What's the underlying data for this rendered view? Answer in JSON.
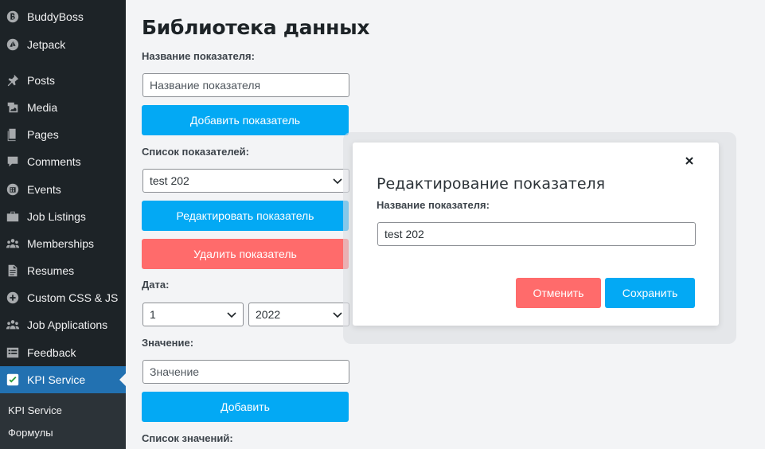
{
  "sidebar": {
    "items": [
      {
        "label": "BuddyBoss",
        "icon": "buddyboss-icon"
      },
      {
        "label": "Jetpack",
        "icon": "jetpack-icon"
      },
      {
        "label": "Posts",
        "icon": "pin-icon"
      },
      {
        "label": "Media",
        "icon": "media-icon"
      },
      {
        "label": "Pages",
        "icon": "pages-icon"
      },
      {
        "label": "Comments",
        "icon": "comment-icon"
      },
      {
        "label": "Events",
        "icon": "calendar-icon"
      },
      {
        "label": "Job Listings",
        "icon": "briefcase-icon"
      },
      {
        "label": "Memberships",
        "icon": "groups-icon"
      },
      {
        "label": "Resumes",
        "icon": "document-icon"
      },
      {
        "label": "Custom CSS & JS",
        "icon": "plus-circle-icon"
      },
      {
        "label": "Job Applications",
        "icon": "groups-icon"
      },
      {
        "label": "Feedback",
        "icon": "feedback-icon"
      },
      {
        "label": "KPI Service",
        "icon": "kpi-icon",
        "active": true
      }
    ],
    "submenu": [
      {
        "label": "KPI Service"
      },
      {
        "label": "Формулы"
      }
    ],
    "active_color": "#2271b1"
  },
  "main": {
    "title": "Библиотека данных",
    "indicator_name_label": "Название показателя:",
    "indicator_name_placeholder": "Название показателя",
    "add_indicator_button": "Добавить показатель",
    "indicator_list_label": "Список показателей:",
    "indicator_selected": "test 202",
    "edit_indicator_button": "Редактировать показатель",
    "delete_indicator_button": "Удалить показатель",
    "date_label": "Дата:",
    "date_day": "1",
    "date_year": "2022",
    "value_label": "Значение:",
    "value_placeholder": "Значение",
    "add_button": "Добавить",
    "values_list_label": "Список значений:"
  },
  "modal": {
    "title": "Редактирование показателя",
    "name_label": "Название показателя:",
    "name_value": "test 202",
    "cancel_button": "Отменить",
    "save_button": "Сохранить"
  },
  "colors": {
    "primary_button": "#03a9f4",
    "danger_button": "#ff6b6b",
    "sidebar_bg": "#1d2327"
  }
}
